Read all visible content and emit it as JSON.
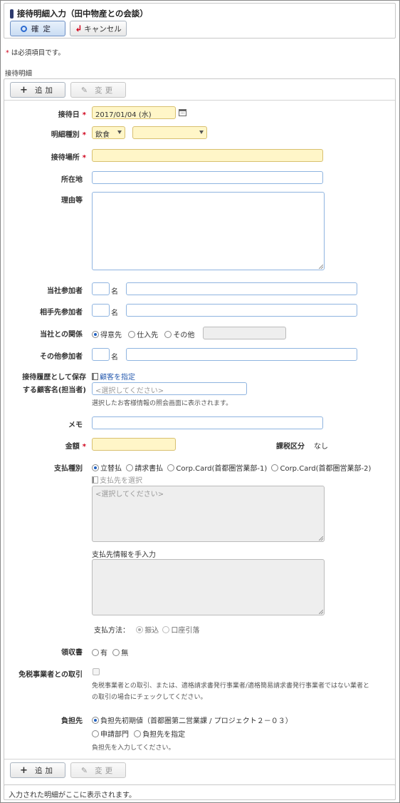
{
  "header": {
    "title": "接待明細入力（田中物産との会談）",
    "confirm_label": "確定",
    "cancel_label": "キャンセル"
  },
  "notice": {
    "asterisk": "*",
    "text": "は必須項目です。"
  },
  "section_title": "接待明細",
  "toolbar": {
    "add_label": "追加",
    "change_label": "変更"
  },
  "form": {
    "date": {
      "label": "接待日",
      "value": "2017/01/04 (水)"
    },
    "detail_type": {
      "label": "明細種別",
      "value1": "飲食",
      "value2": ""
    },
    "place": {
      "label": "接待場所",
      "value": ""
    },
    "address": {
      "label": "所在地",
      "value": ""
    },
    "reason": {
      "label": "理由等",
      "value": ""
    },
    "own_participants": {
      "label": "当社参加者",
      "unit": "名",
      "count": "",
      "names": ""
    },
    "partner_participants": {
      "label": "相手先参加者",
      "unit": "名",
      "count": "",
      "names": ""
    },
    "relation": {
      "label": "当社との関係",
      "options": [
        "得意先",
        "仕入先",
        "その他"
      ],
      "selected": "得意先",
      "other_value": ""
    },
    "other_participants": {
      "label": "その他参加者",
      "unit": "名",
      "count": "",
      "names": ""
    },
    "history": {
      "label_line1": "接待履歴として保存",
      "label_line2": "する顧客名(担当者)",
      "link": "顧客を指定",
      "placeholder": "<選択してください>",
      "hint": "選択したお客様情報の照会画面に表示されます。"
    },
    "memo": {
      "label": "メモ",
      "value": ""
    },
    "amount": {
      "label": "金額",
      "value": ""
    },
    "tax": {
      "label": "課税区分",
      "value": "なし"
    },
    "payment_type": {
      "label": "支払種別",
      "options": [
        "立替払",
        "請求書払",
        "Corp.Card(首都圏営業部-1)",
        "Corp.Card(首都圏営業部-2)"
      ],
      "selected": "立替払",
      "select_link": "支払先を選択",
      "select_placeholder": "<選択してください>",
      "manual_label": "支払先情報を手入力",
      "method_label": "支払方法：",
      "method_options": [
        "振込",
        "口座引落"
      ],
      "method_selected": "振込"
    },
    "receipt": {
      "label": "領収書",
      "options": [
        "有",
        "無"
      ]
    },
    "tax_exempt": {
      "label": "免税事業者との取引",
      "hint_line1": "免税事業者との取引、または、適格請求書発行事業者/適格簡易請求書発行事業者ではない業者と",
      "hint_line2": "の取引の場合にチェックしてください。"
    },
    "burden": {
      "label": "負担先",
      "option1": "負担先初期値（首都圏第二営業課 / プロジェクト２－０３）",
      "option2": "申請部門",
      "option3": "負担先を指定",
      "hint": "負担先を入力してください。"
    }
  },
  "footer": {
    "text": "入力された明細がここに表示されます。"
  },
  "colors": {
    "required_bg": "#fff6c8",
    "input_border": "#8fb4e0",
    "required_mark": "#d0021b",
    "title_bar": "#2d3a6e"
  }
}
